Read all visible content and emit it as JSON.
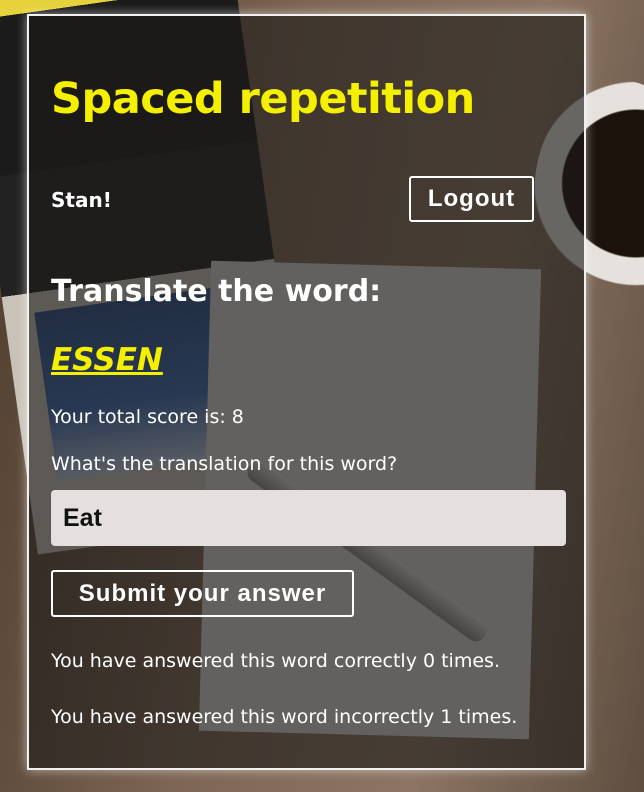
{
  "app": {
    "title": "Spaced repetition"
  },
  "header": {
    "username": "Stan!",
    "logout_label": "Logout"
  },
  "learn": {
    "prompt": "Translate the word:",
    "word": "ESSEN",
    "score_text": "Your total score is: 8",
    "question": "What's the translation for this word?",
    "answer_value": "Eat",
    "submit_label": "Submit your answer",
    "correct_text": "You have answered this word correctly 0 times.",
    "incorrect_text": "You have answered this word incorrectly 1 times."
  },
  "colors": {
    "accent": "#f4f000",
    "input_bg": "#e5dfdf"
  }
}
